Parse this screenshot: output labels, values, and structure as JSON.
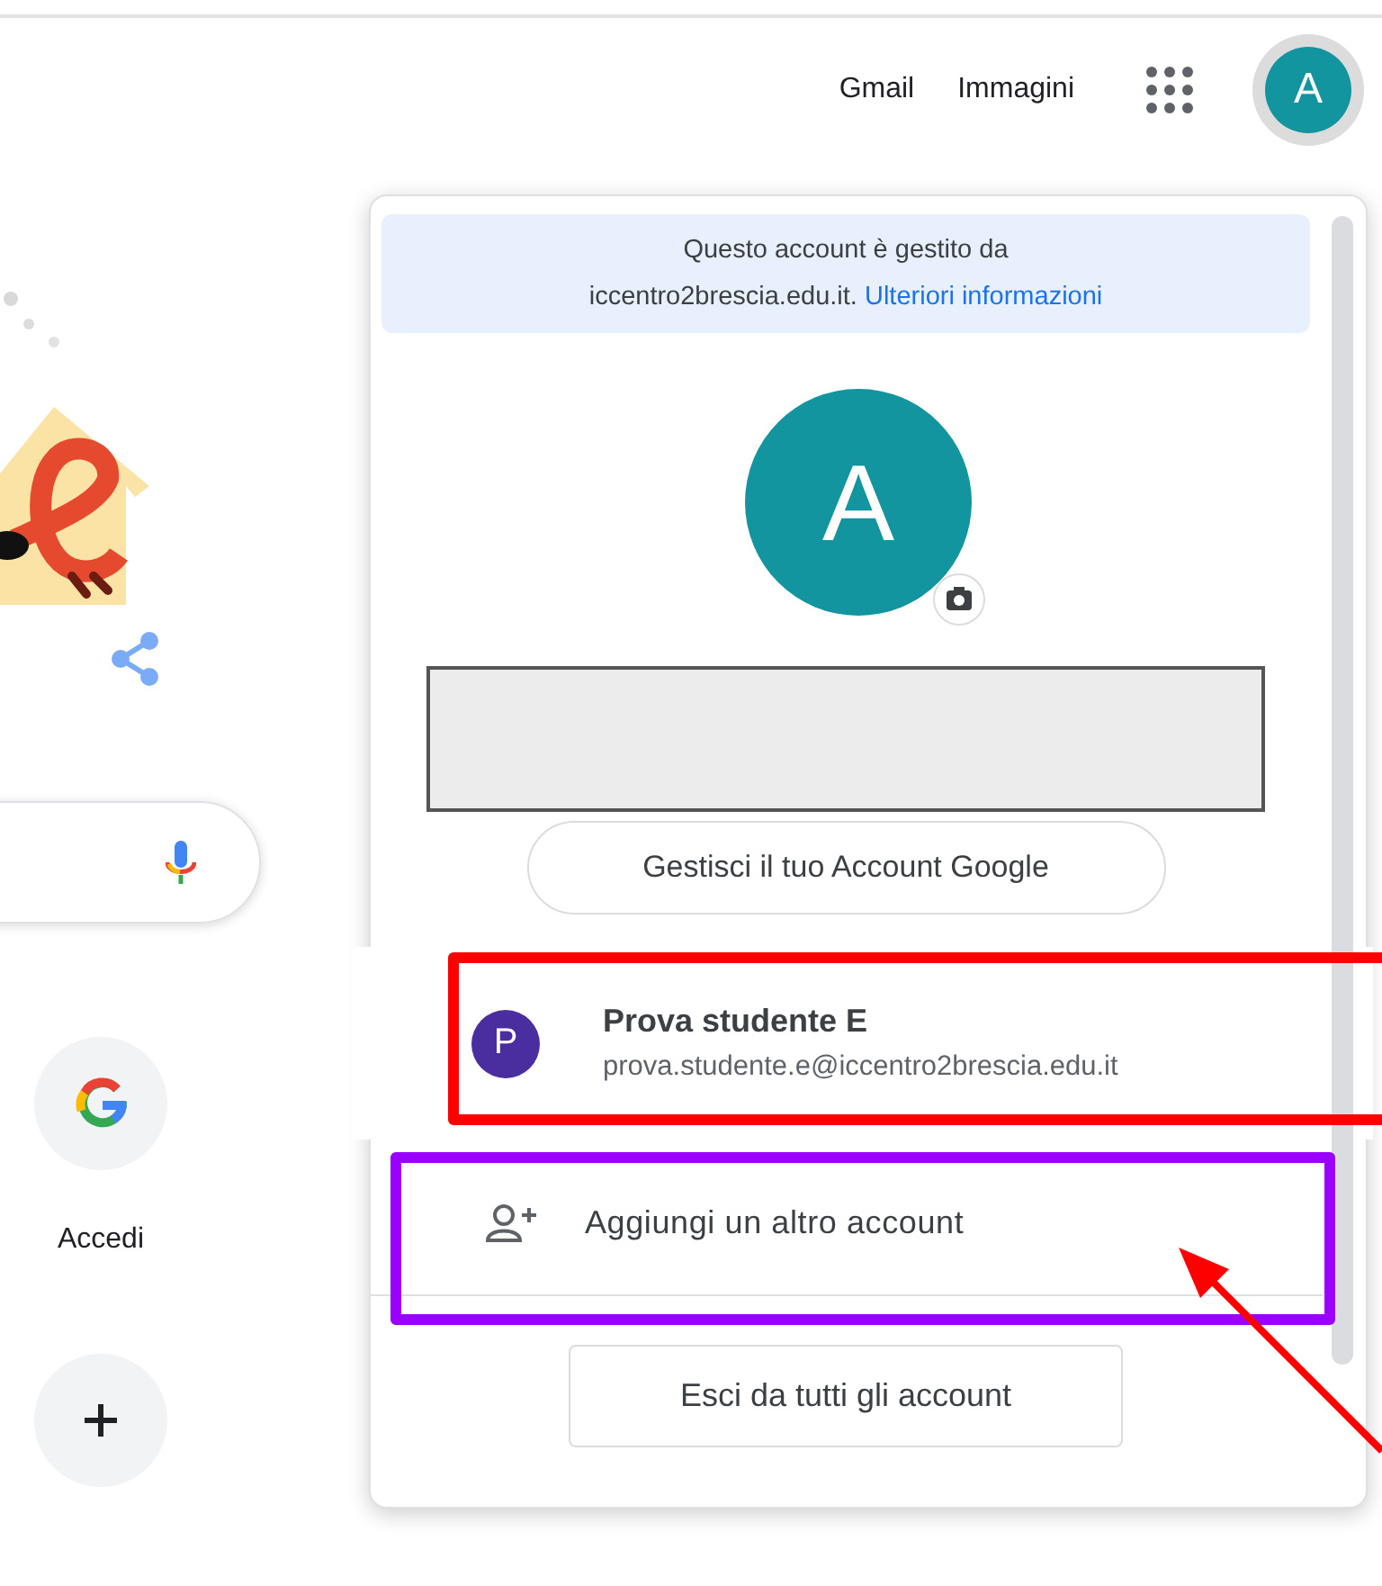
{
  "header": {
    "links": [
      {
        "label": "Gmail"
      },
      {
        "label": "Immagini"
      }
    ],
    "avatar_letter": "A"
  },
  "left": {
    "shortcuts": [
      {
        "kind": "google",
        "label": "Accedi"
      },
      {
        "kind": "add"
      }
    ]
  },
  "menu": {
    "notice_lines": [
      "Questo account è gestito da",
      "iccentro2brescia.edu.it."
    ],
    "notice_link": "Ulteriori informazioni",
    "avatar_letter": "A",
    "manage_button": "Gestisci il tuo Account Google",
    "accounts": [
      {
        "initial": "P",
        "name": "Prova studente E",
        "email": "prova.studente.e@iccentro2brescia.edu.it"
      }
    ],
    "add_account": "Aggiungi un altro account",
    "sign_out_button": "Esci da tutti gli account"
  },
  "annotations": [
    {
      "kind": "box",
      "color": "#ff0000"
    },
    {
      "kind": "box",
      "color": "#9900ff"
    },
    {
      "kind": "arrow",
      "color": "#ff0000"
    }
  ]
}
